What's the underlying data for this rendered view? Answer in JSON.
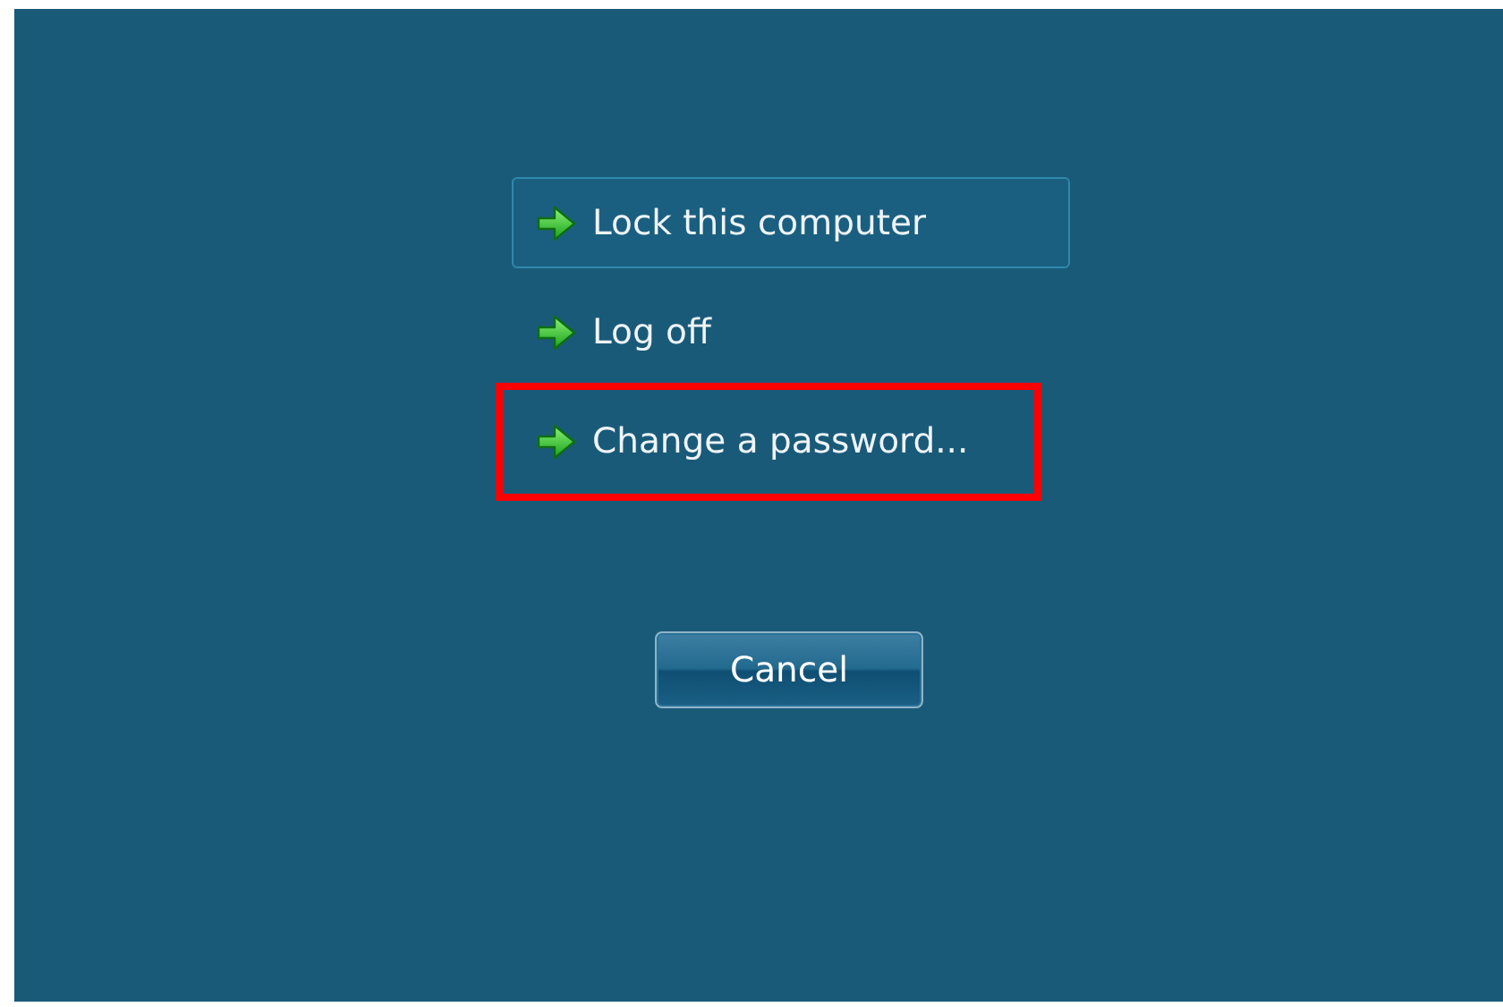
{
  "options": [
    {
      "label": "Lock this computer",
      "selected": true,
      "highlighted": false
    },
    {
      "label": "Log off",
      "selected": false,
      "highlighted": false
    },
    {
      "label": "Change a password...",
      "selected": false,
      "highlighted": true
    }
  ],
  "cancel_button": "Cancel"
}
